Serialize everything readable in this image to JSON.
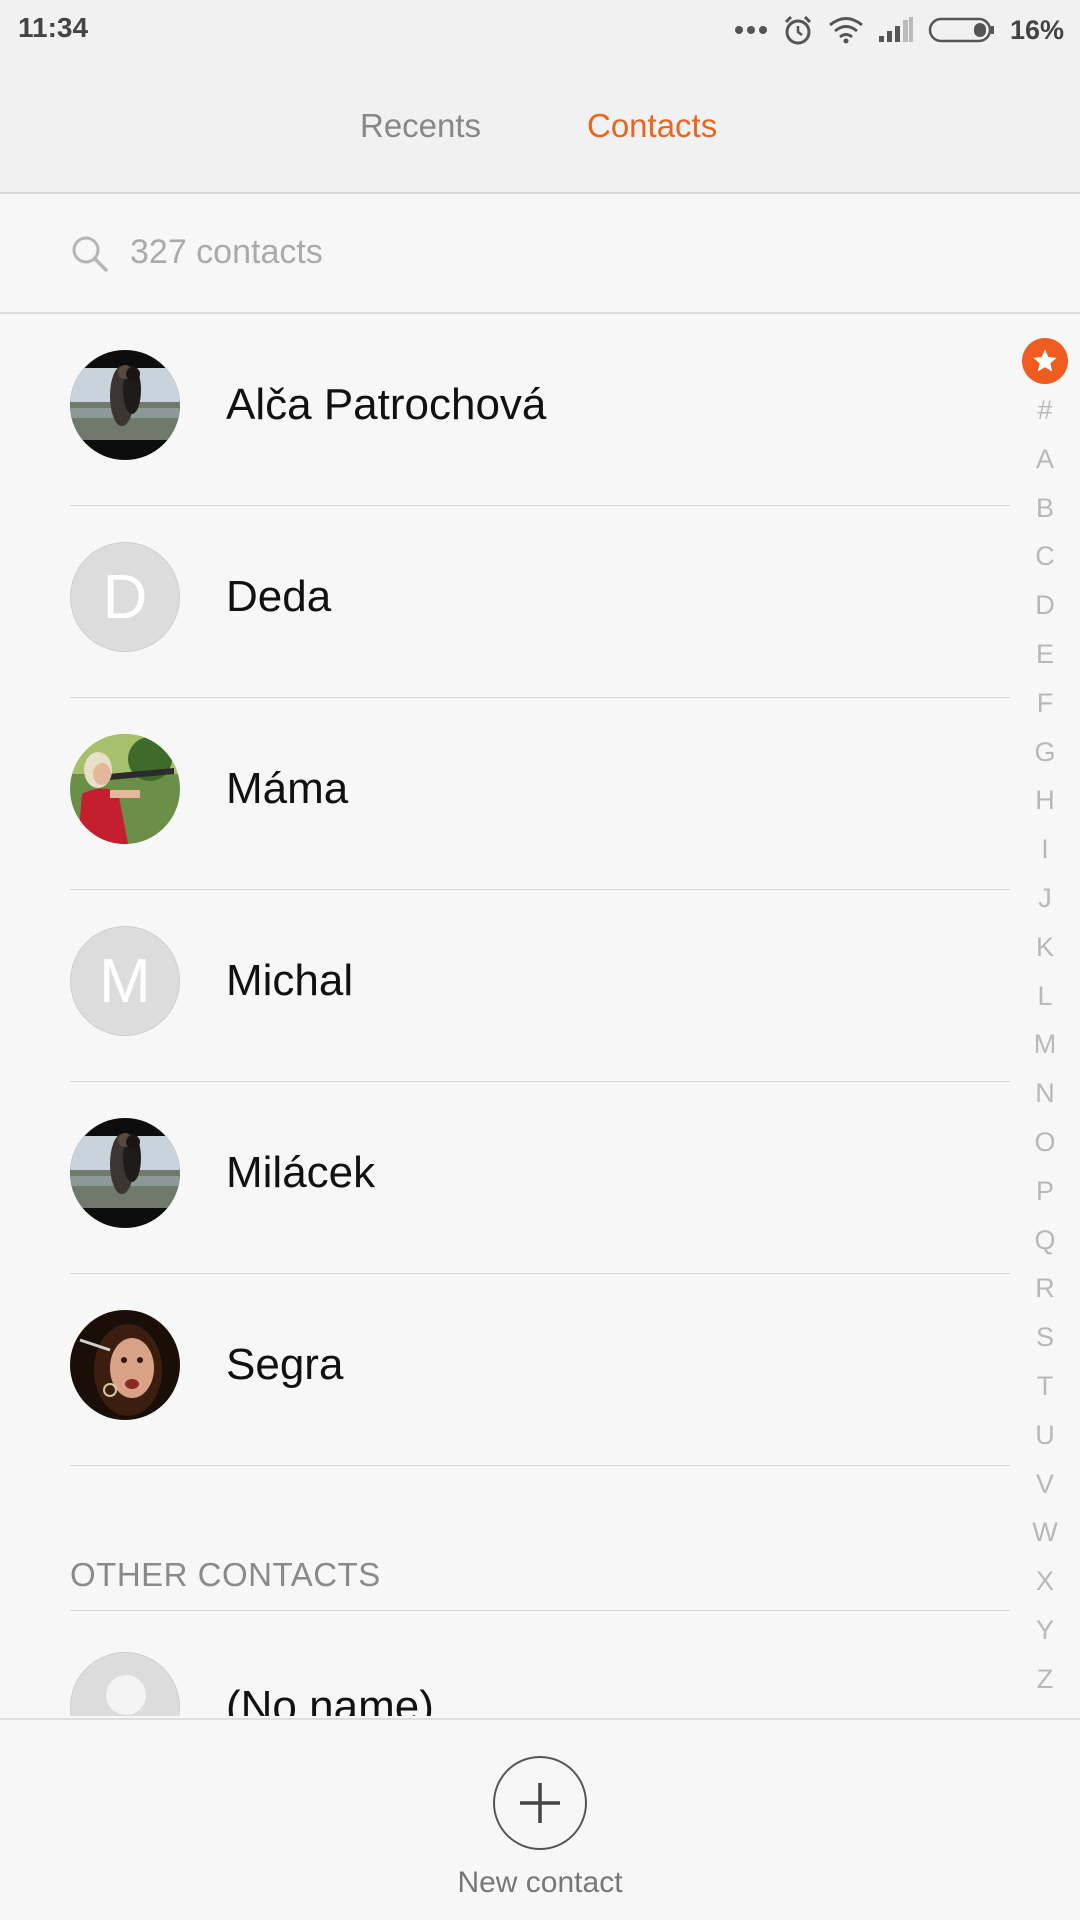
{
  "status": {
    "time": "11:34",
    "battery": "16%"
  },
  "tabs": {
    "recents": "Recents",
    "contacts": "Contacts",
    "active": "contacts"
  },
  "search": {
    "placeholder": "327 contacts"
  },
  "contacts": [
    {
      "name": "Alča Patrochová",
      "avatar": "photo-couple-cliff"
    },
    {
      "name": "Deda",
      "avatar": "letter",
      "letter": "D"
    },
    {
      "name": "Máma",
      "avatar": "photo-woman-red-shirt"
    },
    {
      "name": "Michal",
      "avatar": "letter",
      "letter": "M"
    },
    {
      "name": "Milácek",
      "avatar": "photo-couple-cliff"
    },
    {
      "name": "Segra",
      "avatar": "photo-woman-dark"
    }
  ],
  "other": {
    "header": "OTHER CONTACTS",
    "noname": "(No name)"
  },
  "index": [
    "#",
    "A",
    "B",
    "C",
    "D",
    "E",
    "F",
    "G",
    "H",
    "I",
    "J",
    "K",
    "L",
    "M",
    "N",
    "O",
    "P",
    "Q",
    "R",
    "S",
    "T",
    "U",
    "V",
    "W",
    "X",
    "Y",
    "Z"
  ],
  "bottom": {
    "new_contact": "New contact"
  },
  "colors": {
    "accent": "#e8661e",
    "star": "#ef5c20"
  }
}
